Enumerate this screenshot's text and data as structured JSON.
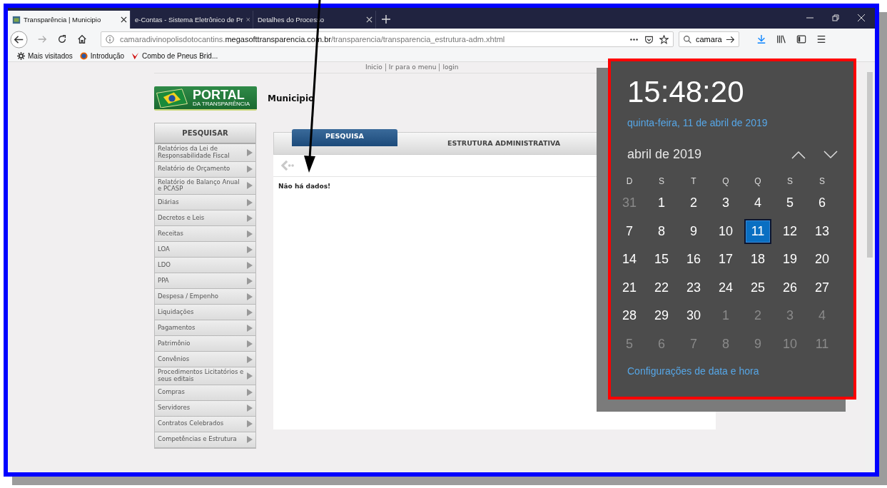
{
  "browser": {
    "tabs": [
      {
        "title": "Transparência | Municipio",
        "selected": true
      },
      {
        "title": "e-Contas - Sistema Eletrônico de Pr",
        "selected": false
      },
      {
        "title": "Detalhes do Processo",
        "selected": false
      }
    ],
    "address_bar": {
      "prefix": "camaradivinopolisdotocantins.",
      "domain": "megasofttransparencia.com.br",
      "path": "/transparencia/transparencia_estrutura-adm.xhtml"
    },
    "search_box": {
      "value": "camara"
    },
    "bookmarks": [
      {
        "label": "Mais visitados",
        "kind": "gear"
      },
      {
        "label": "Introdução",
        "kind": "globe"
      },
      {
        "label": "Combo de Pneus Brid...",
        "kind": "v"
      }
    ]
  },
  "page": {
    "top_links": [
      "Inicio",
      "Ir para o menu",
      "login"
    ],
    "logo": {
      "title": "PORTAL",
      "subtitle": "DA TRANSPARÊNCIA"
    },
    "heading": "Municipio",
    "sidebar": {
      "title": "PESQUISAR",
      "items": [
        "Relatórios da Lei de Responsabilidade Fiscal",
        "Relatório de Orçamento",
        "Relatório de Balanço Anual e PCASP",
        "Diárias",
        "Decretos e Leis",
        "Receitas",
        "LOA",
        "LDO",
        "PPA",
        "Despesa / Empenho",
        "Liquidações",
        "Pagamentos",
        "Patrimônio",
        "Convênios",
        "Procedimentos Licitatórios e seus editais",
        "Compras",
        "Servidores",
        "Contratos Celebrados",
        "Competências e Estrutura"
      ]
    },
    "content_tabs": [
      {
        "label": "PESQUISA",
        "selected": true
      },
      {
        "label": "ESTRUTURA ADMINISTRATIVA",
        "selected": false
      }
    ],
    "message": "Não há dados!"
  },
  "calendar": {
    "time": "15:48:20",
    "date": "quinta-feira, 11 de abril de 2019",
    "month": "abril de 2019",
    "weekdays": [
      "D",
      "S",
      "T",
      "Q",
      "Q",
      "S",
      "S"
    ],
    "weeks": [
      [
        {
          "day": "31",
          "current_month": false,
          "selected": false
        },
        {
          "day": "1",
          "current_month": true,
          "selected": false
        },
        {
          "day": "2",
          "current_month": true,
          "selected": false
        },
        {
          "day": "3",
          "current_month": true,
          "selected": false
        },
        {
          "day": "4",
          "current_month": true,
          "selected": false
        },
        {
          "day": "5",
          "current_month": true,
          "selected": false
        },
        {
          "day": "6",
          "current_month": true,
          "selected": false
        }
      ],
      [
        {
          "day": "7",
          "current_month": true,
          "selected": false
        },
        {
          "day": "8",
          "current_month": true,
          "selected": false
        },
        {
          "day": "9",
          "current_month": true,
          "selected": false
        },
        {
          "day": "10",
          "current_month": true,
          "selected": false
        },
        {
          "day": "11",
          "current_month": true,
          "selected": true
        },
        {
          "day": "12",
          "current_month": true,
          "selected": false
        },
        {
          "day": "13",
          "current_month": true,
          "selected": false
        }
      ],
      [
        {
          "day": "14",
          "current_month": true,
          "selected": false
        },
        {
          "day": "15",
          "current_month": true,
          "selected": false
        },
        {
          "day": "16",
          "current_month": true,
          "selected": false
        },
        {
          "day": "17",
          "current_month": true,
          "selected": false
        },
        {
          "day": "18",
          "current_month": true,
          "selected": false
        },
        {
          "day": "19",
          "current_month": true,
          "selected": false
        },
        {
          "day": "20",
          "current_month": true,
          "selected": false
        }
      ],
      [
        {
          "day": "21",
          "current_month": true,
          "selected": false
        },
        {
          "day": "22",
          "current_month": true,
          "selected": false
        },
        {
          "day": "23",
          "current_month": true,
          "selected": false
        },
        {
          "day": "24",
          "current_month": true,
          "selected": false
        },
        {
          "day": "25",
          "current_month": true,
          "selected": false
        },
        {
          "day": "26",
          "current_month": true,
          "selected": false
        },
        {
          "day": "27",
          "current_month": true,
          "selected": false
        }
      ],
      [
        {
          "day": "28",
          "current_month": true,
          "selected": false
        },
        {
          "day": "29",
          "current_month": true,
          "selected": false
        },
        {
          "day": "30",
          "current_month": true,
          "selected": false
        },
        {
          "day": "1",
          "current_month": false,
          "selected": false
        },
        {
          "day": "2",
          "current_month": false,
          "selected": false
        },
        {
          "day": "3",
          "current_month": false,
          "selected": false
        },
        {
          "day": "4",
          "current_month": false,
          "selected": false
        }
      ],
      [
        {
          "day": "5",
          "current_month": false,
          "selected": false
        },
        {
          "day": "6",
          "current_month": false,
          "selected": false
        },
        {
          "day": "7",
          "current_month": false,
          "selected": false
        },
        {
          "day": "8",
          "current_month": false,
          "selected": false
        },
        {
          "day": "9",
          "current_month": false,
          "selected": false
        },
        {
          "day": "10",
          "current_month": false,
          "selected": false
        },
        {
          "day": "11",
          "current_month": false,
          "selected": false
        }
      ]
    ],
    "settings_link": "Configurações de data e hora"
  }
}
